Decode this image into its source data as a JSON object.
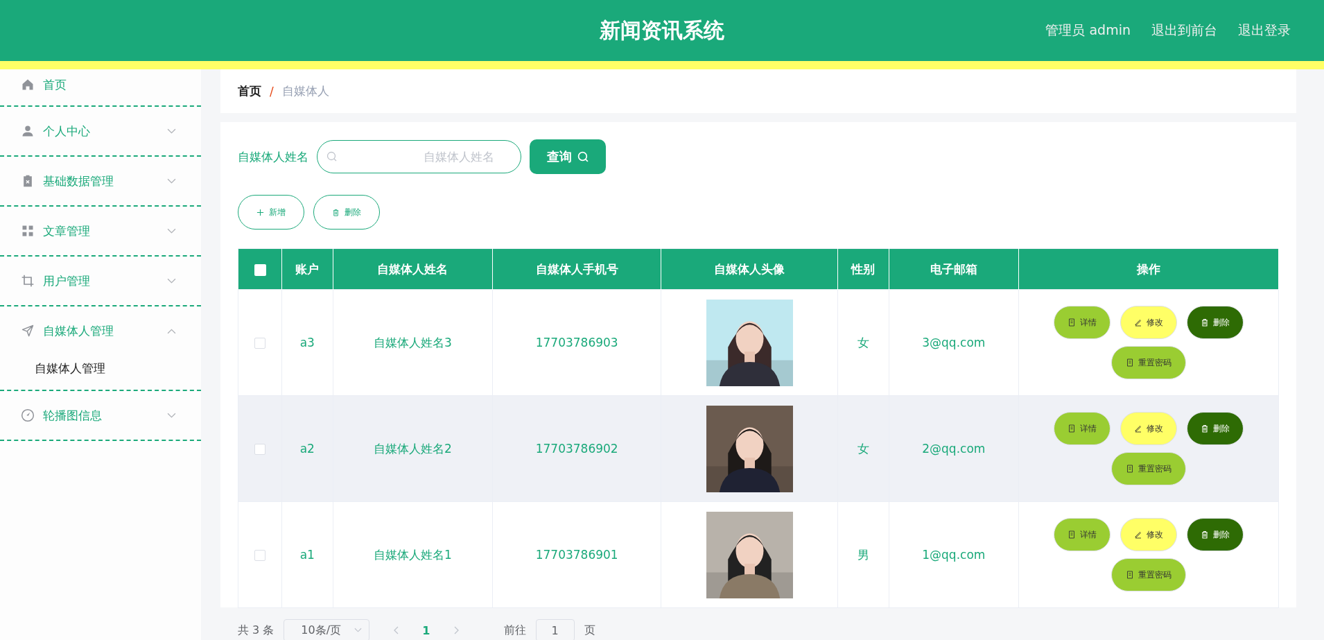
{
  "header": {
    "title": "新闻资讯系统",
    "links": [
      "管理员 admin",
      "退出到前台",
      "退出登录"
    ]
  },
  "sidebar": {
    "items": [
      {
        "label": "首页"
      },
      {
        "label": "个人中心",
        "expanded": false
      },
      {
        "label": "基础数据管理",
        "expanded": false
      },
      {
        "label": "文章管理",
        "expanded": false
      },
      {
        "label": "用户管理",
        "expanded": false
      },
      {
        "label": "自媒体人管理",
        "expanded": true,
        "children": [
          {
            "label": "自媒体人管理"
          }
        ]
      },
      {
        "label": "轮播图信息",
        "expanded": false
      }
    ]
  },
  "breadcrumb": [
    "首页",
    "/",
    "自媒体人"
  ],
  "search": {
    "label": "自媒体人姓名",
    "placeholder": "自媒体人姓名",
    "button": "查询"
  },
  "actions": [
    "新增",
    "删除"
  ],
  "table": {
    "columns": [
      "账户",
      "自媒体人姓名",
      "自媒体人手机号",
      "自媒体人头像",
      "性别",
      "电子邮箱",
      "操作"
    ],
    "all_checked": false,
    "rows": [
      {
        "checked": false,
        "account": "a3",
        "name": "自媒体人姓名3",
        "phone": "17703786903",
        "gender": "女",
        "email": "3@qq.com",
        "highlighted": false,
        "buttons": [
          {
            "label": "详情",
            "kind": "detail"
          },
          {
            "label": "修改",
            "kind": "edit"
          },
          {
            "label": "删除",
            "kind": "delete"
          },
          {
            "label": "重置密码",
            "kind": "reset"
          }
        ]
      },
      {
        "checked": false,
        "account": "a2",
        "name": "自媒体人姓名2",
        "phone": "17703786902",
        "gender": "女",
        "email": "2@qq.com",
        "highlighted": true,
        "buttons": [
          {
            "label": "详情",
            "kind": "detail"
          },
          {
            "label": "修改",
            "kind": "edit"
          },
          {
            "label": "删除",
            "kind": "delete"
          },
          {
            "label": "重置密码",
            "kind": "reset"
          }
        ]
      },
      {
        "checked": false,
        "account": "a1",
        "name": "自媒体人姓名1",
        "phone": "17703786901",
        "gender": "男",
        "email": "1@qq.com",
        "highlighted": false,
        "buttons": [
          {
            "label": "详情",
            "kind": "detail"
          },
          {
            "label": "修改",
            "kind": "edit"
          },
          {
            "label": "删除",
            "kind": "delete"
          },
          {
            "label": "重置密码",
            "kind": "reset"
          }
        ]
      }
    ]
  },
  "pagination": {
    "total": "共 3 条",
    "page_size": "10条/页",
    "current": "1",
    "goto": "前往",
    "goto_value": "1",
    "page_unit": "页"
  }
}
